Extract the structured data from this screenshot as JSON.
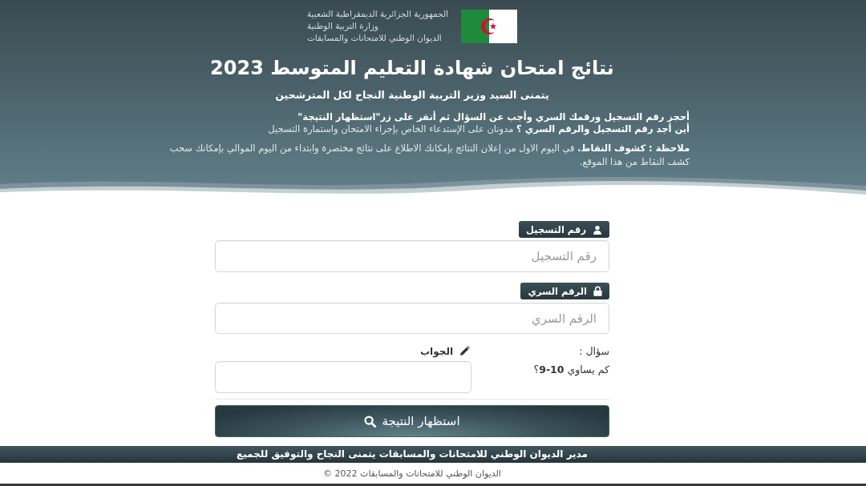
{
  "header": {
    "emblem_lines": [
      "الجمهورية الجزائرية الديمقراطية الشعبية",
      "وزارة التربية الوطنية",
      "الديوان الوطني للامتحانات والمسابقات"
    ],
    "title": "نتائج امتحان شهادة التعليم المتوسط 2023",
    "subtitle": "يتمنى السيد وزير التربية الوطنية النجاح لكل المترشحين",
    "instruction": "أحجز رقم التسجيل ورقمك السري وأجب عن السؤال ثم أنقر على زر\"استظهار النتيجة\"",
    "hint": "**أين أجد رقم التسجيل والرقم السري ؟** مدونان على الإستدعاء الخاص بإجراء الامتحان واستمارة التسجيل",
    "note": "**ملاحظة : كشوف النقاط.** في اليوم الاول من إعلان النتائج بإمكانك الاطلاع على نتائج مختصرة وابتداء من اليوم الموالي بإمكانك سحب كشف النقاط من هذا الموقع."
  },
  "form": {
    "fields": [
      {
        "kind": "id",
        "label": "رقم التسجيل",
        "placeholder": "رقم التسجيل"
      },
      {
        "kind": "password",
        "label": "الرقم السري",
        "placeholder": "الرقم السري"
      }
    ],
    "question": {
      "label": "سؤال :",
      "text": "كم يساوي **10-9**؟"
    },
    "answer": {
      "label": "الجواب"
    },
    "submit": "استظهار النتيجة"
  },
  "footer": {
    "banner": "مدير الديوان الوطني للامتحانات والمسابقات يتمنى النجاح والتوفيق للجميع",
    "copyright": "الديوان الوطني للامتحانات والمسابقات 2022 ©"
  }
}
